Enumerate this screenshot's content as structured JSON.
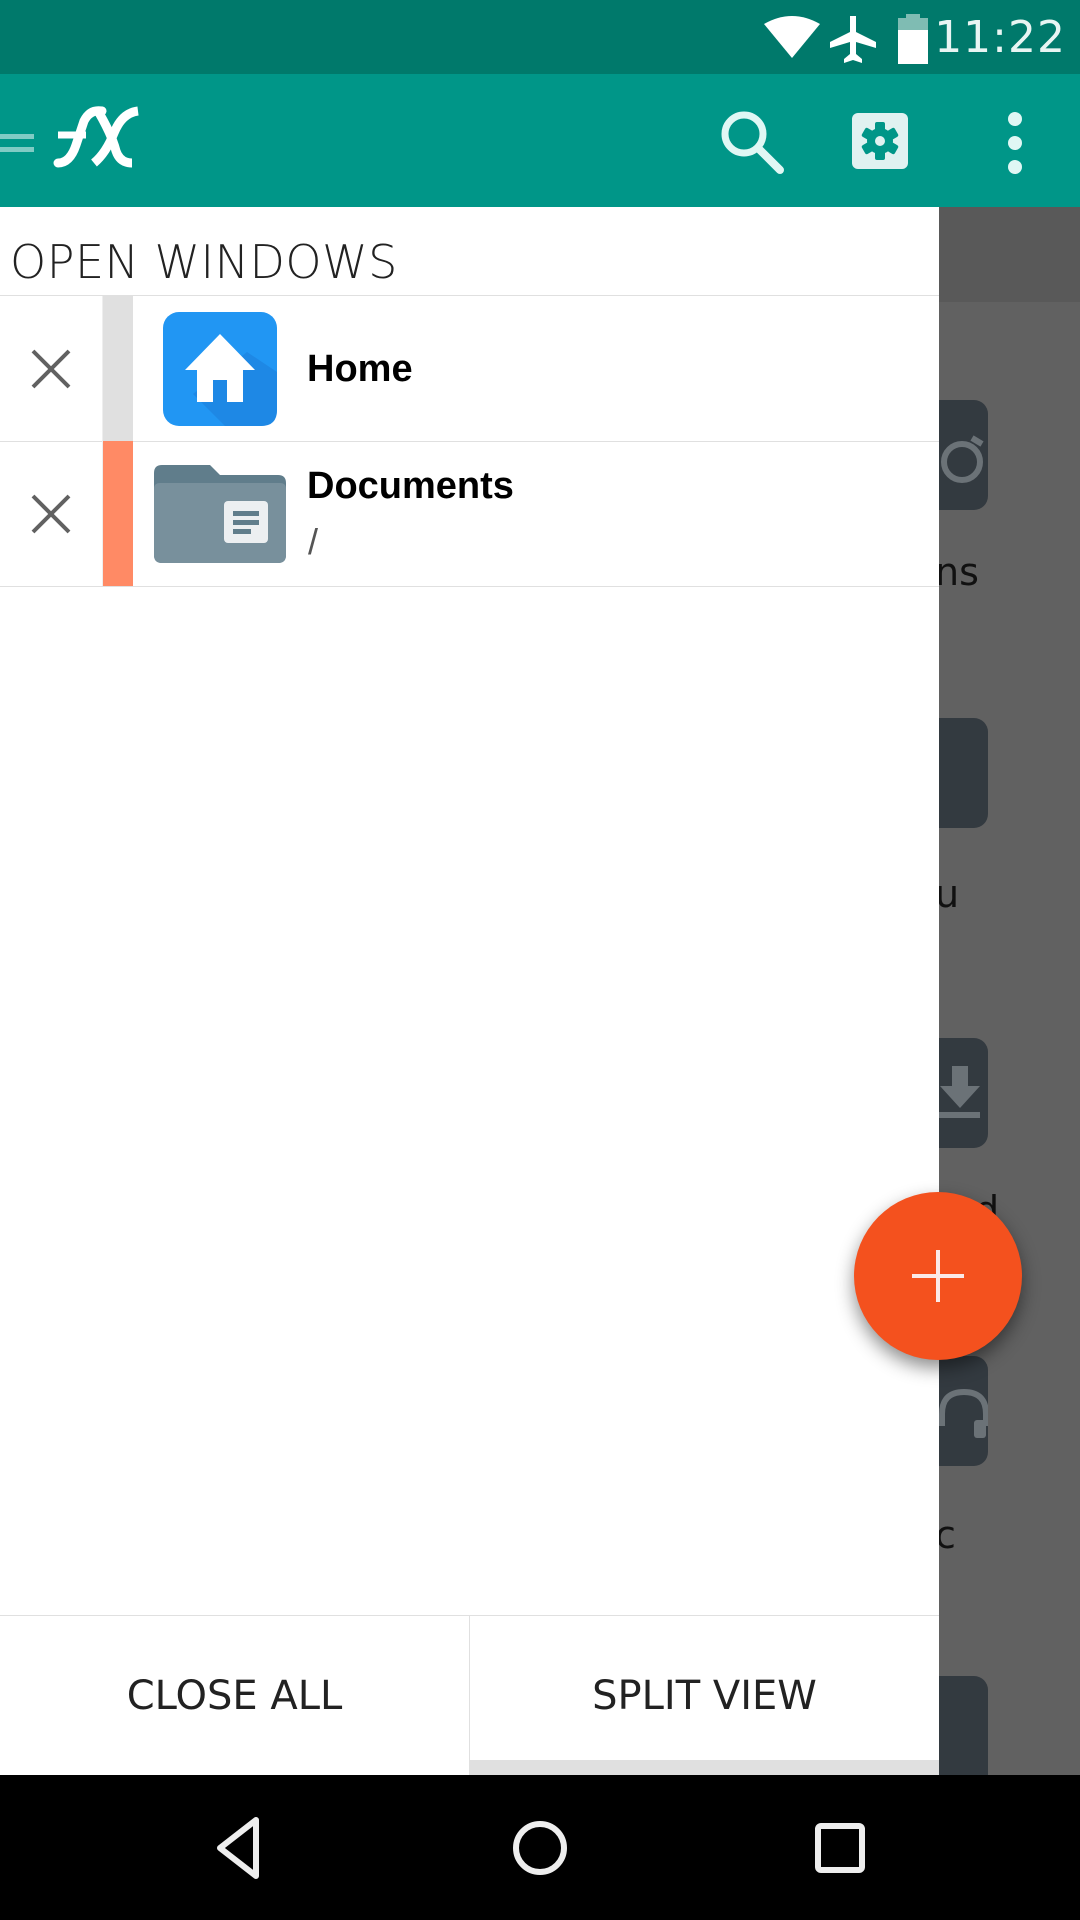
{
  "status_bar": {
    "time": "11:22",
    "icons": [
      "wifi-icon",
      "airplane-mode-icon",
      "battery-icon"
    ]
  },
  "toolbar": {
    "app_logo": "FX",
    "actions": [
      "search-icon",
      "settings-icon",
      "overflow-menu-icon"
    ]
  },
  "drawer": {
    "title": "OPEN WINDOWS",
    "windows": [
      {
        "title": "Home",
        "subtitle": "",
        "icon": "home-icon",
        "stripe_color": "#e0e0e0",
        "close_icon": "close-icon"
      },
      {
        "title": "Documents",
        "subtitle": "/",
        "icon": "documents-folder-icon",
        "stripe_color": "#ff8a65",
        "close_icon": "close-icon"
      }
    ],
    "buttons": {
      "close_all": "CLOSE ALL",
      "split_view": "SPLIT VIEW"
    }
  },
  "background_app": {
    "labels": [
      "ns",
      "u",
      "d",
      "c"
    ]
  },
  "fab": {
    "icon": "add-icon",
    "color": "#f4511e"
  },
  "nav_bar": {
    "buttons": [
      "back-icon",
      "home-icon",
      "recents-icon"
    ]
  },
  "colors": {
    "status_bar": "#00796b",
    "toolbar": "#009688",
    "accent": "#f4511e"
  }
}
